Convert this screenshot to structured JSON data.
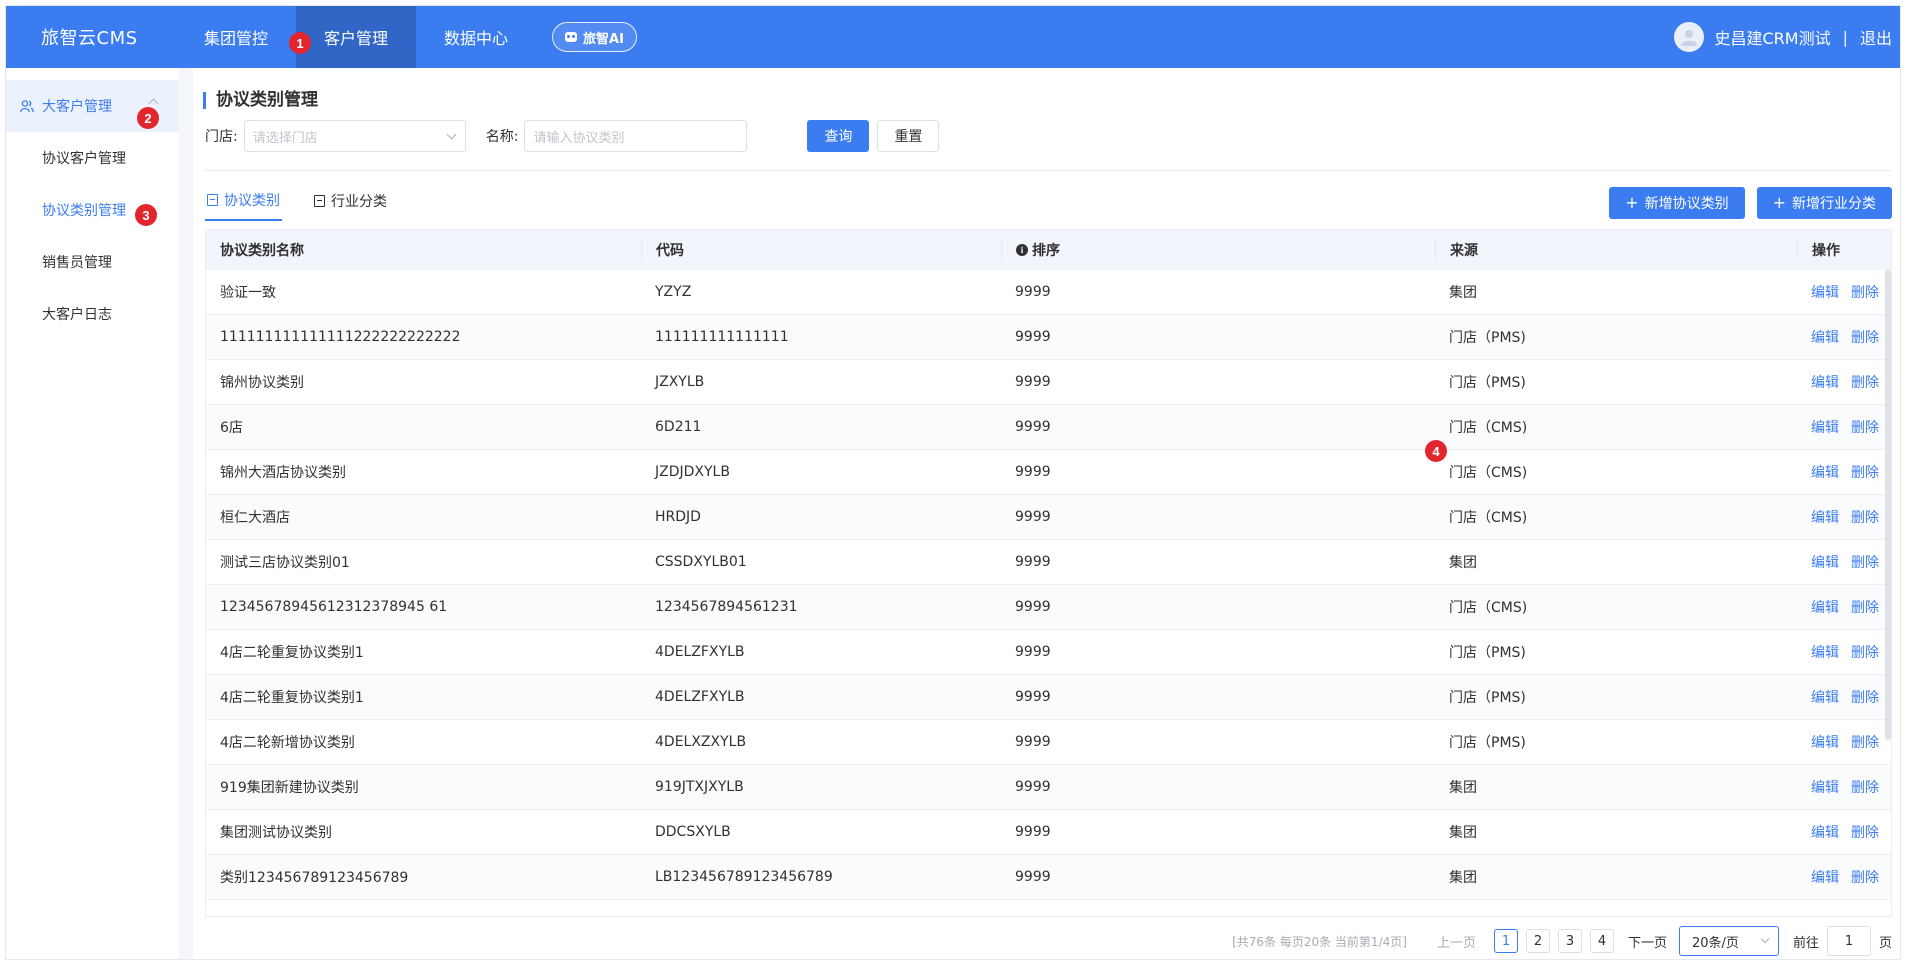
{
  "header": {
    "brand": "旅智云CMS",
    "nav": [
      "集团管控",
      "客户管理",
      "数据中心"
    ],
    "active_nav": "客户管理",
    "ai_label": "旅智AI",
    "user_name": "史昌建CRM测试",
    "separator": "|",
    "logout": "退出"
  },
  "badges": [
    "1",
    "2",
    "3",
    "4"
  ],
  "sidebar": {
    "parent": "大客户管理",
    "items": [
      {
        "label": "协议客户管理"
      },
      {
        "label": "协议类别管理"
      },
      {
        "label": "销售员管理"
      },
      {
        "label": "大客户日志"
      }
    ],
    "active": "协议类别管理"
  },
  "page": {
    "title": "协议类别管理",
    "filters": {
      "store_label": "门店:",
      "store_placeholder": "请选择门店",
      "name_label": "名称:",
      "name_placeholder": "请输入协议类别"
    },
    "query_btn": "查询",
    "reset_btn": "重置",
    "tabs": [
      "协议类别",
      "行业分类"
    ],
    "add_category_btn": "新增协议类别",
    "add_industry_btn": "新增行业分类"
  },
  "table": {
    "headers": [
      "协议类别名称",
      "代码",
      "排序",
      "来源",
      "操作"
    ],
    "edit": "编辑",
    "delete": "删除",
    "rows": [
      {
        "name": "验证一致",
        "code": "YZYZ",
        "sort": "9999",
        "source": "集团"
      },
      {
        "name": "111111111111111222222222222",
        "code": "111111111111111",
        "sort": "9999",
        "source": "门店（PMS)"
      },
      {
        "name": "锦州协议类别",
        "code": "JZXYLB",
        "sort": "9999",
        "source": "门店（PMS)"
      },
      {
        "name": "6店",
        "code": "6D211",
        "sort": "9999",
        "source": "门店（CMS)"
      },
      {
        "name": "锦州大酒店协议类别",
        "code": "JZDJDXYLB",
        "sort": "9999",
        "source": "门店（CMS)"
      },
      {
        "name": "桓仁大酒店",
        "code": "HRDJD",
        "sort": "9999",
        "source": "门店（CMS)"
      },
      {
        "name": "测试三店协议类别01",
        "code": "CSSDXYLB01",
        "sort": "9999",
        "source": "集团"
      },
      {
        "name": "12345678945612312378945 61",
        "code": "1234567894561231",
        "sort": "9999",
        "source": "门店（CMS)"
      },
      {
        "name": "4店二轮重复协议类别1",
        "code": "4DELZFXYLB",
        "sort": "9999",
        "source": "门店（PMS)"
      },
      {
        "name": "4店二轮重复协议类别1",
        "code": "4DELZFXYLB",
        "sort": "9999",
        "source": "门店（PMS)"
      },
      {
        "name": "4店二轮新增协议类别",
        "code": "4DELXZXYLB",
        "sort": "9999",
        "source": "门店（PMS)"
      },
      {
        "name": "919集团新建协议类别",
        "code": "919JTXJXYLB",
        "sort": "9999",
        "source": "集团"
      },
      {
        "name": "集团测试协议类别",
        "code": "DDCSXYLB",
        "sort": "9999",
        "source": "集团"
      },
      {
        "name": "类别123456789123456789",
        "code": "LB123456789123456789",
        "sort": "9999",
        "source": "集团"
      }
    ]
  },
  "pagination": {
    "summary": "[共76条 每页20条 当前第1/4页]",
    "prev": "上一页",
    "pages": [
      "1",
      "2",
      "3",
      "4"
    ],
    "current": "1",
    "next": "下一页",
    "page_size": "20条/页",
    "goto_label": "前往",
    "goto_value": "1",
    "page_unit": "页"
  },
  "colors": {
    "primary": "#3b7cf0",
    "badge": "#e3262d"
  }
}
